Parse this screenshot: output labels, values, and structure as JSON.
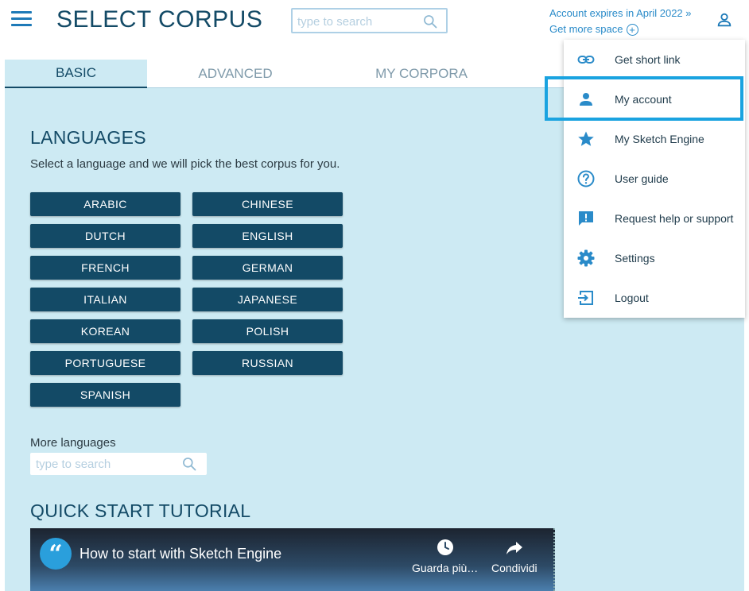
{
  "header": {
    "title": "SELECT CORPUS",
    "search_placeholder": "type to search",
    "account_expiry": "Account expires in April 2022 »",
    "get_more_space": "Get more space",
    "plus_symbol": "+"
  },
  "tabs": [
    {
      "label": "BASIC",
      "active": true
    },
    {
      "label": "ADVANCED",
      "active": false
    },
    {
      "label": "MY CORPORA",
      "active": false
    }
  ],
  "languages": {
    "title": "LANGUAGES",
    "subtitle": "Select a language and we will pick the best corpus for you.",
    "buttons": [
      "ARABIC",
      "CHINESE",
      "DUTCH",
      "ENGLISH",
      "FRENCH",
      "GERMAN",
      "ITALIAN",
      "JAPANESE",
      "KOREAN",
      "POLISH",
      "PORTUGUESE",
      "RUSSIAN",
      "SPANISH"
    ],
    "more_label": "More languages",
    "more_placeholder": "type to search"
  },
  "tutorial": {
    "title": "QUICK START TUTORIAL",
    "video_title": "How to start with Sketch Engine",
    "logo_glyph": "“",
    "watch_later": "Guarda più…",
    "share": "Condividi"
  },
  "user_menu": {
    "items": [
      {
        "label": "Get short link",
        "icon": "link-icon"
      },
      {
        "label": "My account",
        "icon": "person-icon",
        "highlighted": true
      },
      {
        "label": "My Sketch Engine",
        "icon": "star-icon"
      },
      {
        "label": "User guide",
        "icon": "help-circle-icon"
      },
      {
        "label": "Request help or support",
        "icon": "feedback-icon"
      },
      {
        "label": "Settings",
        "icon": "gear-icon"
      },
      {
        "label": "Logout",
        "icon": "logout-icon"
      }
    ]
  },
  "colors": {
    "brand_dark": "#134a66",
    "accent_blue": "#2a8bc9",
    "panel_bg": "#cdeaf3",
    "highlight": "#1aa3e0"
  }
}
